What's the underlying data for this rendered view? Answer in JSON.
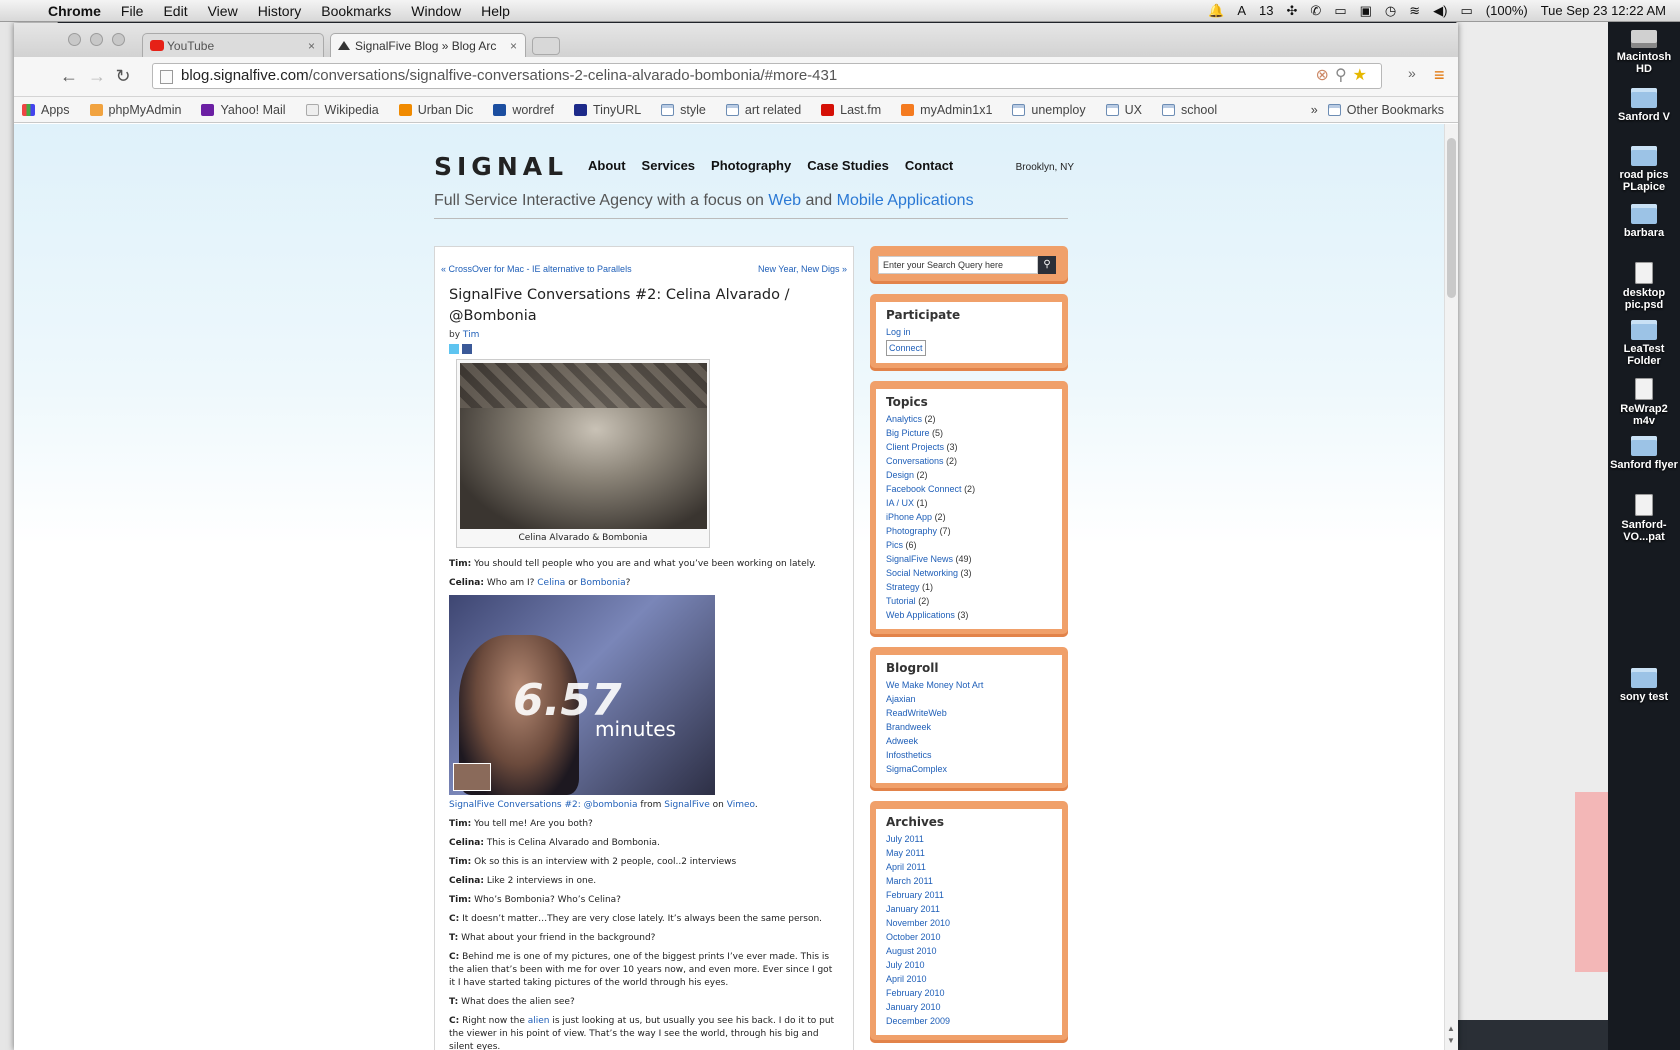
{
  "menubar": {
    "apple": "",
    "items": [
      "Chrome",
      "File",
      "Edit",
      "View",
      "History",
      "Bookmarks",
      "Window",
      "Help"
    ],
    "status": {
      "notifications": "13",
      "battery": "(100%)",
      "datetime": "Tue Sep 23  12:22 AM"
    }
  },
  "desktop": {
    "icons": [
      "Macintosh HD",
      "Sanford V",
      "road pics PLapice",
      "barbara",
      "desktop pic.psd",
      "LeaTest Folder",
      "ReWrap2 m4v",
      "Sanford flyer",
      "Sanford-VO...pat",
      "sony test"
    ]
  },
  "browser": {
    "tabs": [
      {
        "label": "YouTube",
        "close": "×"
      },
      {
        "label": "SignalFive Blog » Blog Arc",
        "close": "×"
      }
    ],
    "url_host": "blog.signalfive.com",
    "url_path": "/conversations/signalfive-conversations-2-celina-alvarado-bombonia/#more-431",
    "bookmarks": [
      "Apps",
      "phpMyAdmin",
      "Yahoo! Mail",
      "Wikipedia",
      "Urban Dic",
      "wordref",
      "TinyURL",
      "style",
      "art related",
      "Last.fm",
      "myAdmin1x1",
      "unemploy",
      "UX",
      "school"
    ],
    "bookmarks_more": "»",
    "other_bookmarks": "Other Bookmarks"
  },
  "site": {
    "logo": "SIGNAL",
    "nav": [
      "About",
      "Services",
      "Photography",
      "Case Studies",
      "Contact"
    ],
    "location": "Brooklyn, NY",
    "tagline_prefix": "Full Service Interactive Agency with a focus on",
    "tagline_web": "Web",
    "tagline_and": "and",
    "tagline_mobile": "Mobile Applications"
  },
  "post": {
    "prev": "« CrossOver for Mac - IE alternative to Parallels",
    "next": "New Year, New Digs »",
    "title": "SignalFive Conversations #2: Celina Alvarado / @Bombonia",
    "by": "by",
    "author": "Tim",
    "figure_caption": "Celina Alvarado & Bombonia",
    "video_duration": "6.57",
    "video_unit": "minutes",
    "video_title": "SignalFive Conversations #2: @bombonia",
    "video_from": "from",
    "video_source": "SignalFive",
    "video_on": "on",
    "video_host": "Vimeo",
    "p1_speaker": "Tim:",
    "p1_text": "You should tell people who you are and what you’ve been working on lately.",
    "p2_speaker": "Celina:",
    "p2_text": "Who am I?",
    "p2_link1": "Celina",
    "p2_or": "or",
    "p2_link2": "Bombonia",
    "p2_q": "?",
    "dialogue": [
      {
        "s": "Tim:",
        "t": "You tell me! Are you both?"
      },
      {
        "s": "Celina:",
        "t": "This is Celina Alvarado and Bombonia."
      },
      {
        "s": "Tim:",
        "t": "Ok so this is an interview with 2 people, cool..2 interviews"
      },
      {
        "s": "Celina:",
        "t": "Like 2 interviews in one."
      },
      {
        "s": "Tim:",
        "t": "Who’s Bombonia? Who’s Celina?"
      },
      {
        "s": "C:",
        "t": "It doesn’t matter…They are very close lately. It’s always been the same person."
      },
      {
        "s": "T:",
        "t": "What about your friend in the background?"
      },
      {
        "s": "C:",
        "t": "Behind me is one of my pictures, one of the biggest prints I’ve ever made. This is the alien that’s been with me for over 10 years now, and even more. Ever since I got it I have started taking pictures of the world through his eyes."
      },
      {
        "s": "T:",
        "t": "What does the alien see?"
      }
    ],
    "last_speaker": "C:",
    "last_a": "Right now the",
    "last_link": "alien",
    "last_b": "is just looking at us, but usually you see his back. I do it to put the viewer in his point of view. That’s the way I see the world, through his big and silent eyes."
  },
  "sidebar": {
    "search_placeholder": "Enter your Search Query here",
    "participate_title": "Participate",
    "login": "Log in",
    "connect": "Connect",
    "topics_title": "Topics",
    "topics": [
      {
        "name": "Analytics",
        "count": "(2)"
      },
      {
        "name": "Big Picture",
        "count": "(5)"
      },
      {
        "name": "Client Projects",
        "count": "(3)"
      },
      {
        "name": "Conversations",
        "count": "(2)"
      },
      {
        "name": "Design",
        "count": "(2)"
      },
      {
        "name": "Facebook Connect",
        "count": "(2)"
      },
      {
        "name": "IA / UX",
        "count": "(1)"
      },
      {
        "name": "iPhone App",
        "count": "(2)"
      },
      {
        "name": "Photography",
        "count": "(7)"
      },
      {
        "name": "Pics",
        "count": "(6)"
      },
      {
        "name": "SignalFive News",
        "count": "(49)"
      },
      {
        "name": "Social Networking",
        "count": "(3)"
      },
      {
        "name": "Strategy",
        "count": "(1)"
      },
      {
        "name": "Tutorial",
        "count": "(2)"
      },
      {
        "name": "Web Applications",
        "count": "(3)"
      }
    ],
    "blogroll_title": "Blogroll",
    "blogroll": [
      "We Make Money Not Art",
      "Ajaxian",
      "ReadWriteWeb",
      "Brandweek",
      "Adweek",
      "Infosthetics",
      "SigmaComplex"
    ],
    "archives_title": "Archives",
    "archives": [
      "July 2011",
      "May 2011",
      "April 2011",
      "March 2011",
      "February 2011",
      "January 2011",
      "November 2010",
      "October 2010",
      "August 2010",
      "July 2010",
      "April 2010",
      "February 2010",
      "January 2010",
      "December 2009"
    ]
  }
}
